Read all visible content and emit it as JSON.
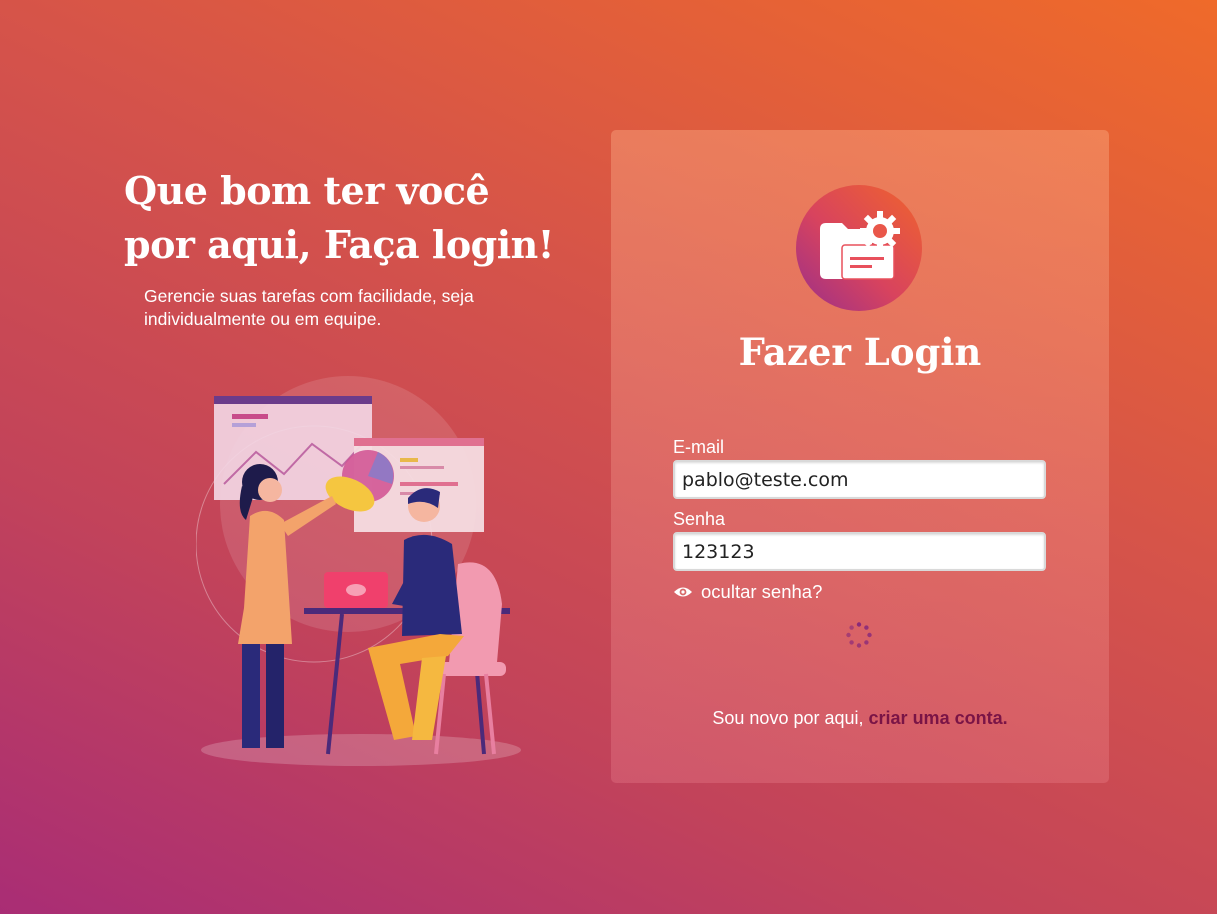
{
  "hero": {
    "title": "Que bom ter você por aqui, Faça login!",
    "subtitle": "Gerencie suas tarefas com facilidade, seja individualmente ou em equipe."
  },
  "login": {
    "title": "Fazer Login",
    "email_label": "E-mail",
    "email_value": "pablo@teste.com",
    "password_label": "Senha",
    "password_value": "123123",
    "toggle_password_label": "ocultar senha?",
    "footer_prefix": "Sou novo por aqui,",
    "signup_link": "criar uma conta."
  },
  "icons": {
    "logo": "folder-gear-icon",
    "toggle": "eye-icon",
    "loading": "spinner-icon"
  },
  "colors": {
    "link": "#7a1446",
    "spinner": "#8a2a7a"
  }
}
